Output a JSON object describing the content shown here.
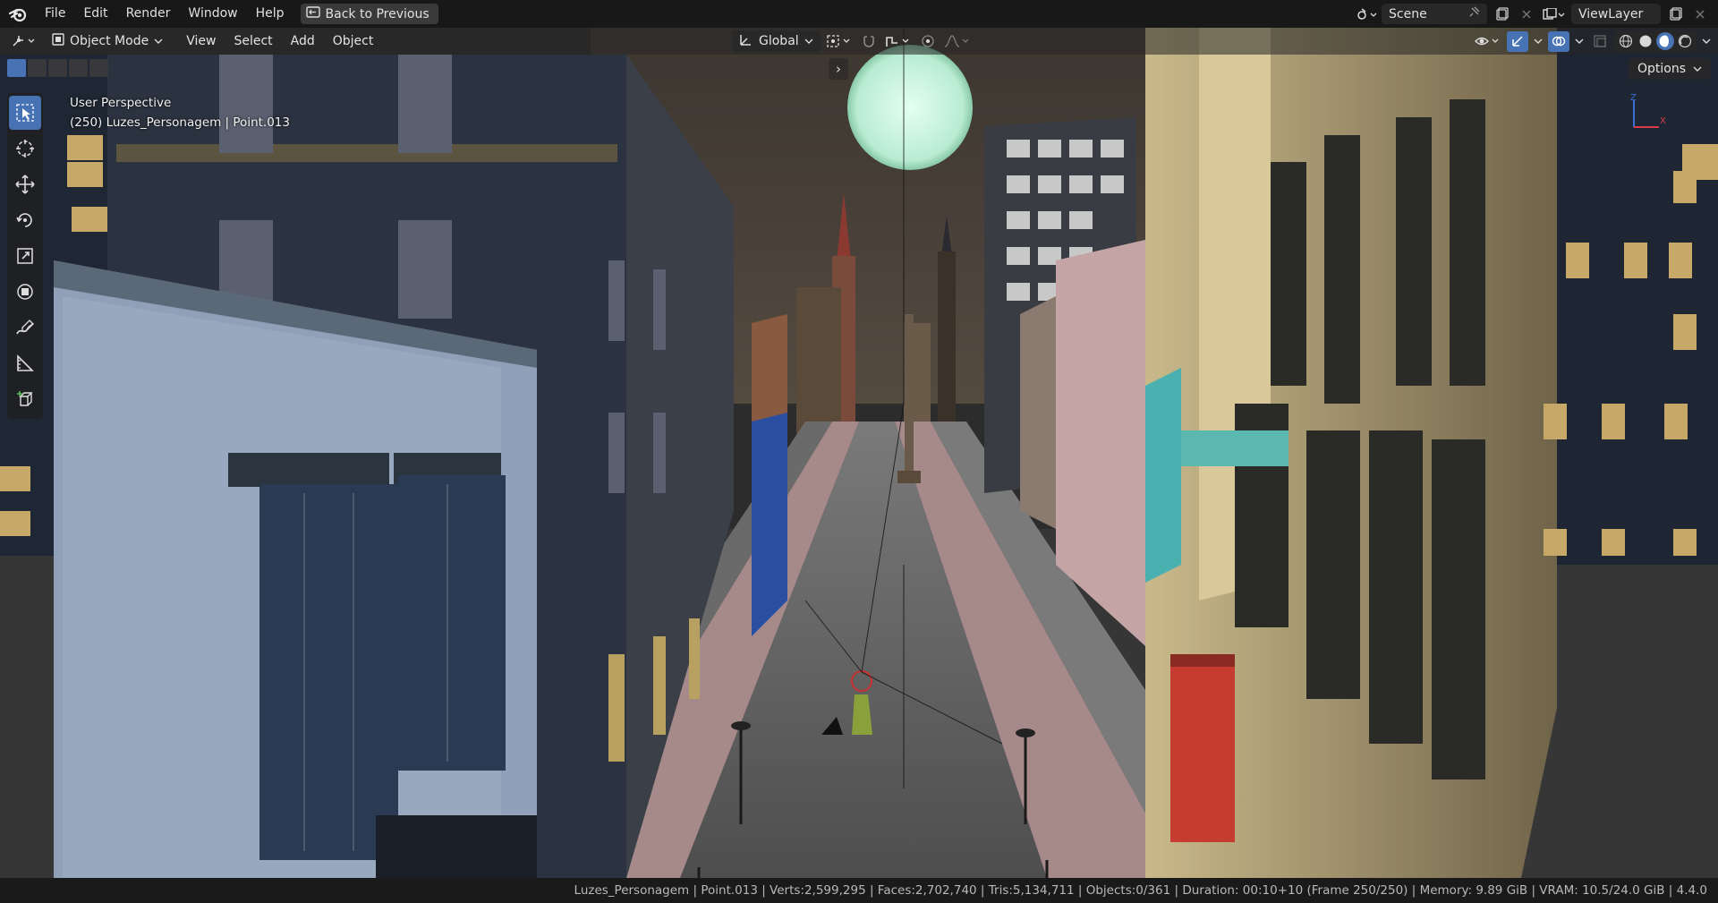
{
  "menubar": {
    "items": [
      "File",
      "Edit",
      "Render",
      "Window",
      "Help"
    ],
    "back_button": "Back to Previous",
    "scene": "Scene",
    "view_layer": "ViewLayer"
  },
  "viewport_header": {
    "mode": "Object Mode",
    "menus": [
      "View",
      "Select",
      "Add",
      "Object"
    ],
    "transform_orientation": "Global",
    "options_label": "Options"
  },
  "viewport": {
    "perspective": "User Perspective",
    "active_object": "(250) Luzes_Personagem | Point.013",
    "gizmo_axes": {
      "up": "Z",
      "right": "X"
    }
  },
  "toolbar": {
    "tools": [
      "select-box",
      "cursor",
      "move",
      "rotate",
      "scale",
      "transform",
      "annotate",
      "measure",
      "add-cube"
    ],
    "active_tool": "select-box"
  },
  "statusbar": {
    "text": "Luzes_Personagem | Point.013 | Verts:2,599,295 | Faces:2,702,740 | Tris:5,134,711 | Objects:0/361 | Duration: 00:10+10 (Frame 250/250) | Memory: 9.89 GiB | VRAM: 10.5/24.0 GiB | 4.4.0"
  },
  "colors": {
    "accent": "#4772b3",
    "topbar": "#181818",
    "statusbar": "#1a1a1a",
    "night_sky": "#3a3530",
    "moon": "#c8f0dc"
  }
}
